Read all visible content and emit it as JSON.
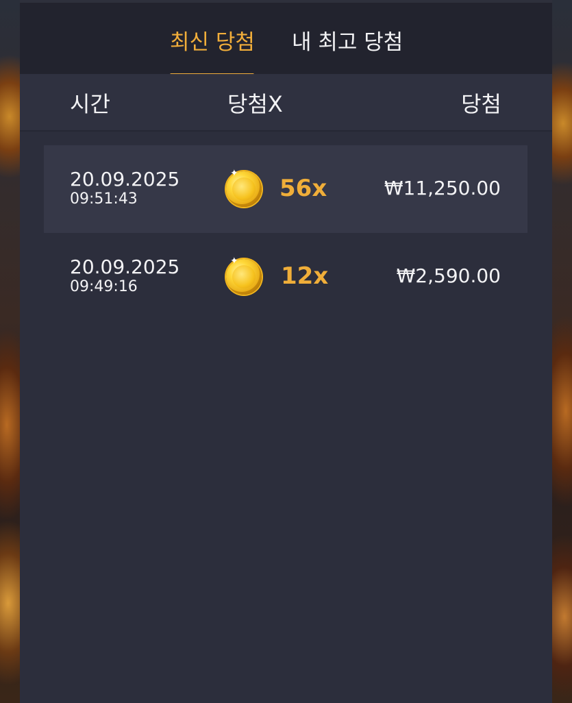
{
  "tabs": [
    {
      "label": "최신 당첨",
      "active": true
    },
    {
      "label": "내 최고 당첨",
      "active": false
    }
  ],
  "columns": {
    "time": "시간",
    "multiplier": "당첨X",
    "win": "당첨"
  },
  "rows": [
    {
      "date": "20.09.2025",
      "time": "09:51:43",
      "icon": "gold-coin-icon",
      "multiplier": "56x",
      "amount": "₩11,250.00"
    },
    {
      "date": "20.09.2025",
      "time": "09:49:16",
      "icon": "gold-coin-icon",
      "multiplier": "12x",
      "amount": "₩2,590.00"
    }
  ],
  "colors": {
    "accent": "#f2ae3a",
    "panel": "#2c2e3c",
    "header": "#2f3140",
    "row_highlight": "#363848"
  }
}
